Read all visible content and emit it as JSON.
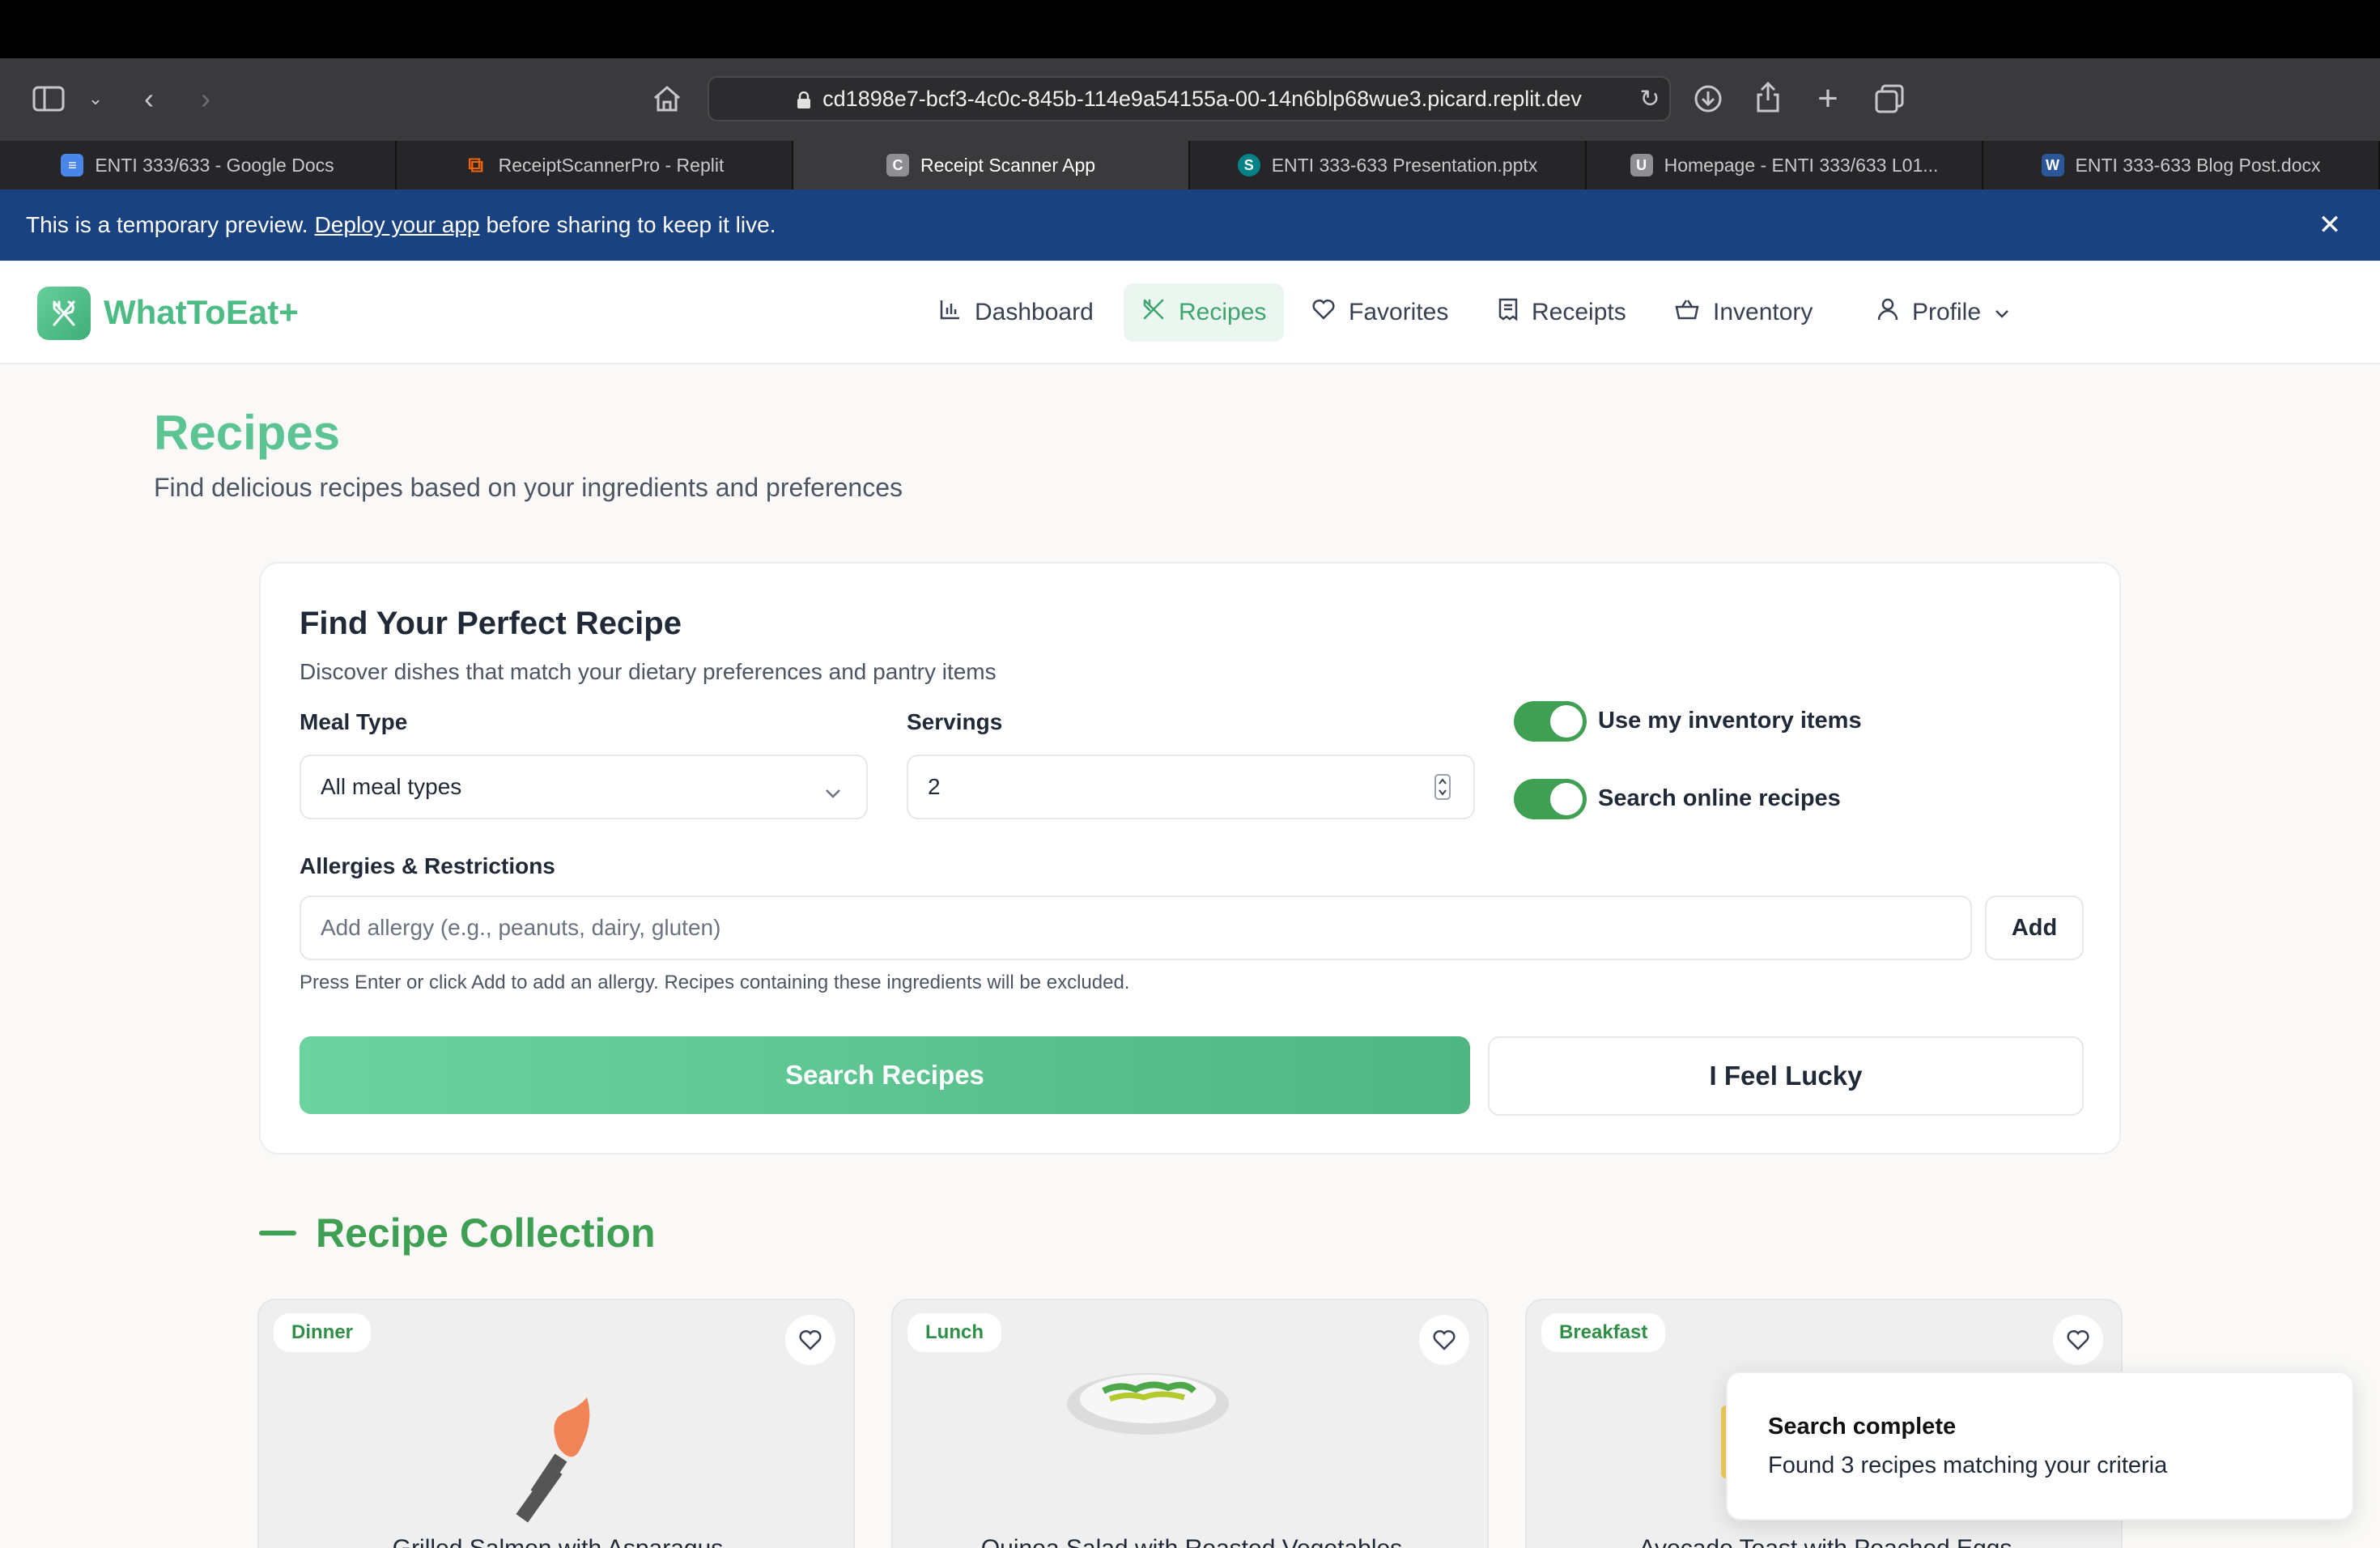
{
  "browser": {
    "url": "cd1898e7-bcf3-4c0c-845b-114e9a54155a-00-14n6blp68wue3.picard.replit.dev",
    "tabs": [
      {
        "label": "ENTI 333/633 - Google Docs",
        "icon": "google-docs-icon",
        "color": "#4a86e8"
      },
      {
        "label": "ReceiptScannerPro - Replit",
        "icon": "replit-icon",
        "color": "#f26207"
      },
      {
        "label": "Receipt Scanner App",
        "icon": "c-favicon-icon",
        "color": "#8e8e93"
      },
      {
        "label": "ENTI 333-633 Presentation.pptx",
        "icon": "sharepoint-icon",
        "color": "#038387"
      },
      {
        "label": "Homepage - ENTI 333/633 L01...",
        "icon": "u-favicon-icon",
        "color": "#8e8e93"
      },
      {
        "label": "ENTI 333-633 Blog Post.docx",
        "icon": "word-icon",
        "color": "#2b579a"
      }
    ],
    "active_tab": 2
  },
  "banner": {
    "prefix": "This is a temporary preview.",
    "link": "Deploy your app",
    "suffix": "before sharing to keep it live."
  },
  "nav": {
    "brand": "WhatToEat+",
    "items": [
      {
        "label": "Dashboard",
        "icon": "bar-chart-icon"
      },
      {
        "label": "Recipes",
        "icon": "utensils-icon"
      },
      {
        "label": "Favorites",
        "icon": "heart-icon"
      },
      {
        "label": "Receipts",
        "icon": "receipt-icon"
      },
      {
        "label": "Inventory",
        "icon": "basket-icon"
      },
      {
        "label": "Profile",
        "icon": "user-icon"
      }
    ],
    "active": "Recipes"
  },
  "page": {
    "title": "Recipes",
    "subtitle": "Find delicious recipes based on your ingredients and preferences"
  },
  "search": {
    "title": "Find Your Perfect Recipe",
    "subtitle": "Discover dishes that match your dietary preferences and pantry items",
    "meal_type_label": "Meal Type",
    "meal_type_value": "All meal types",
    "servings_label": "Servings",
    "servings_value": "2",
    "toggle_inventory": "Use my inventory items",
    "toggle_online": "Search online recipes",
    "toggle_inventory_on": true,
    "toggle_online_on": true,
    "allergies_label": "Allergies & Restrictions",
    "allergy_placeholder": "Add allergy (e.g., peanuts, dairy, gluten)",
    "add_label": "Add",
    "hint": "Press Enter or click Add to add an allergy. Recipes containing these ingredients will be excluded.",
    "search_label": "Search Recipes",
    "lucky_label": "I Feel Lucky"
  },
  "collection": {
    "title": "Recipe Collection",
    "recipes": [
      {
        "badge": "Dinner",
        "title": "Grilled Salmon with Asparagus"
      },
      {
        "badge": "Lunch",
        "title": "Quinoa Salad with Roasted Vegetables"
      },
      {
        "badge": "Breakfast",
        "title": "Avocado Toast with Poached Eggs"
      }
    ]
  },
  "toast": {
    "title": "Search complete",
    "message": "Found 3 recipes matching your criteria"
  },
  "colors": {
    "brand_green": "#4dbb84",
    "toggle_green": "#3f9f52",
    "banner_blue": "#1a4280"
  }
}
